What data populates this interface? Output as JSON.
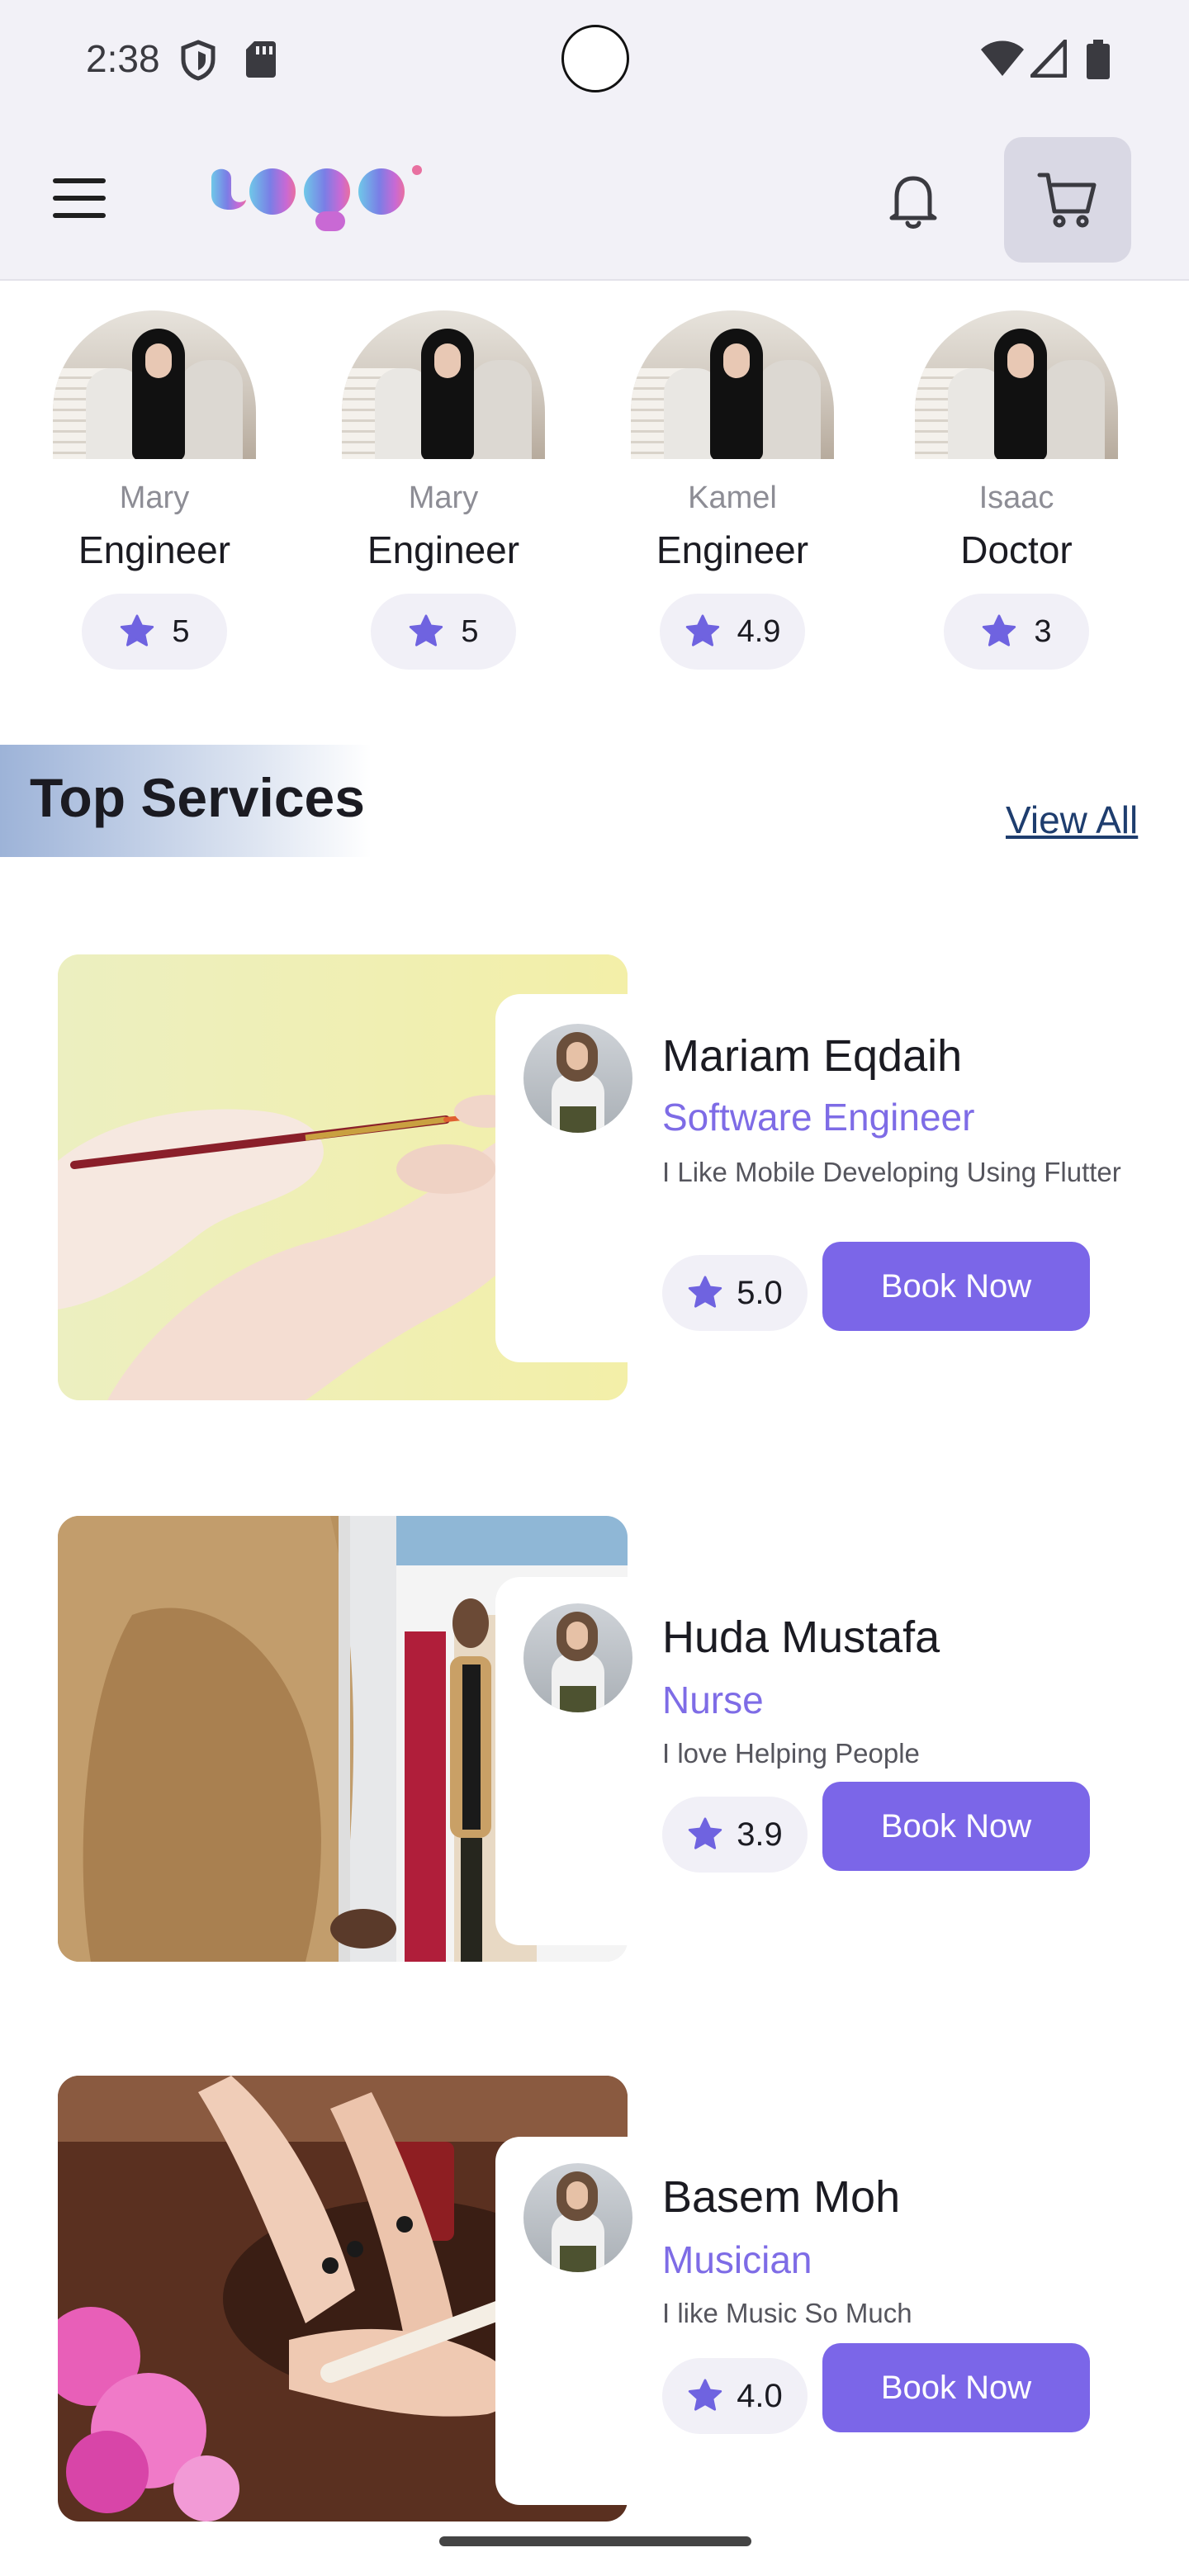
{
  "status_bar": {
    "time": "2:38"
  },
  "app_bar": {
    "logo_text": "Logo"
  },
  "people": [
    {
      "name": "Mary",
      "role": "Engineer",
      "rating": "5"
    },
    {
      "name": "Mary",
      "role": "Engineer",
      "rating": "5"
    },
    {
      "name": "Kamel",
      "role": "Engineer",
      "rating": "4.9"
    },
    {
      "name": "Isaac",
      "role": "Doctor",
      "rating": "3"
    }
  ],
  "section": {
    "title": "Top Services",
    "view_all": "View All"
  },
  "services": [
    {
      "name": "Mariam Eqdaih",
      "role": "Software Engineer",
      "description": "I Like Mobile Developing Using Flutter",
      "rating": "5.0",
      "button": "Book Now",
      "image": "brush-painting-hands"
    },
    {
      "name": "Huda Mustafa",
      "role": "Nurse",
      "description": "I love Helping People",
      "rating": "3.9",
      "button": "Book Now",
      "image": "store-mirror-woman"
    },
    {
      "name": "Basem Moh",
      "role": "Musician",
      "description": "I like Music So Much",
      "rating": "4.0",
      "button": "Book Now",
      "image": "manicure-nail-file"
    }
  ],
  "colors": {
    "accent": "#7b66e8",
    "star": "#6f63e0",
    "link": "#1e3d6e",
    "chip_bg": "#f1f0f7"
  }
}
